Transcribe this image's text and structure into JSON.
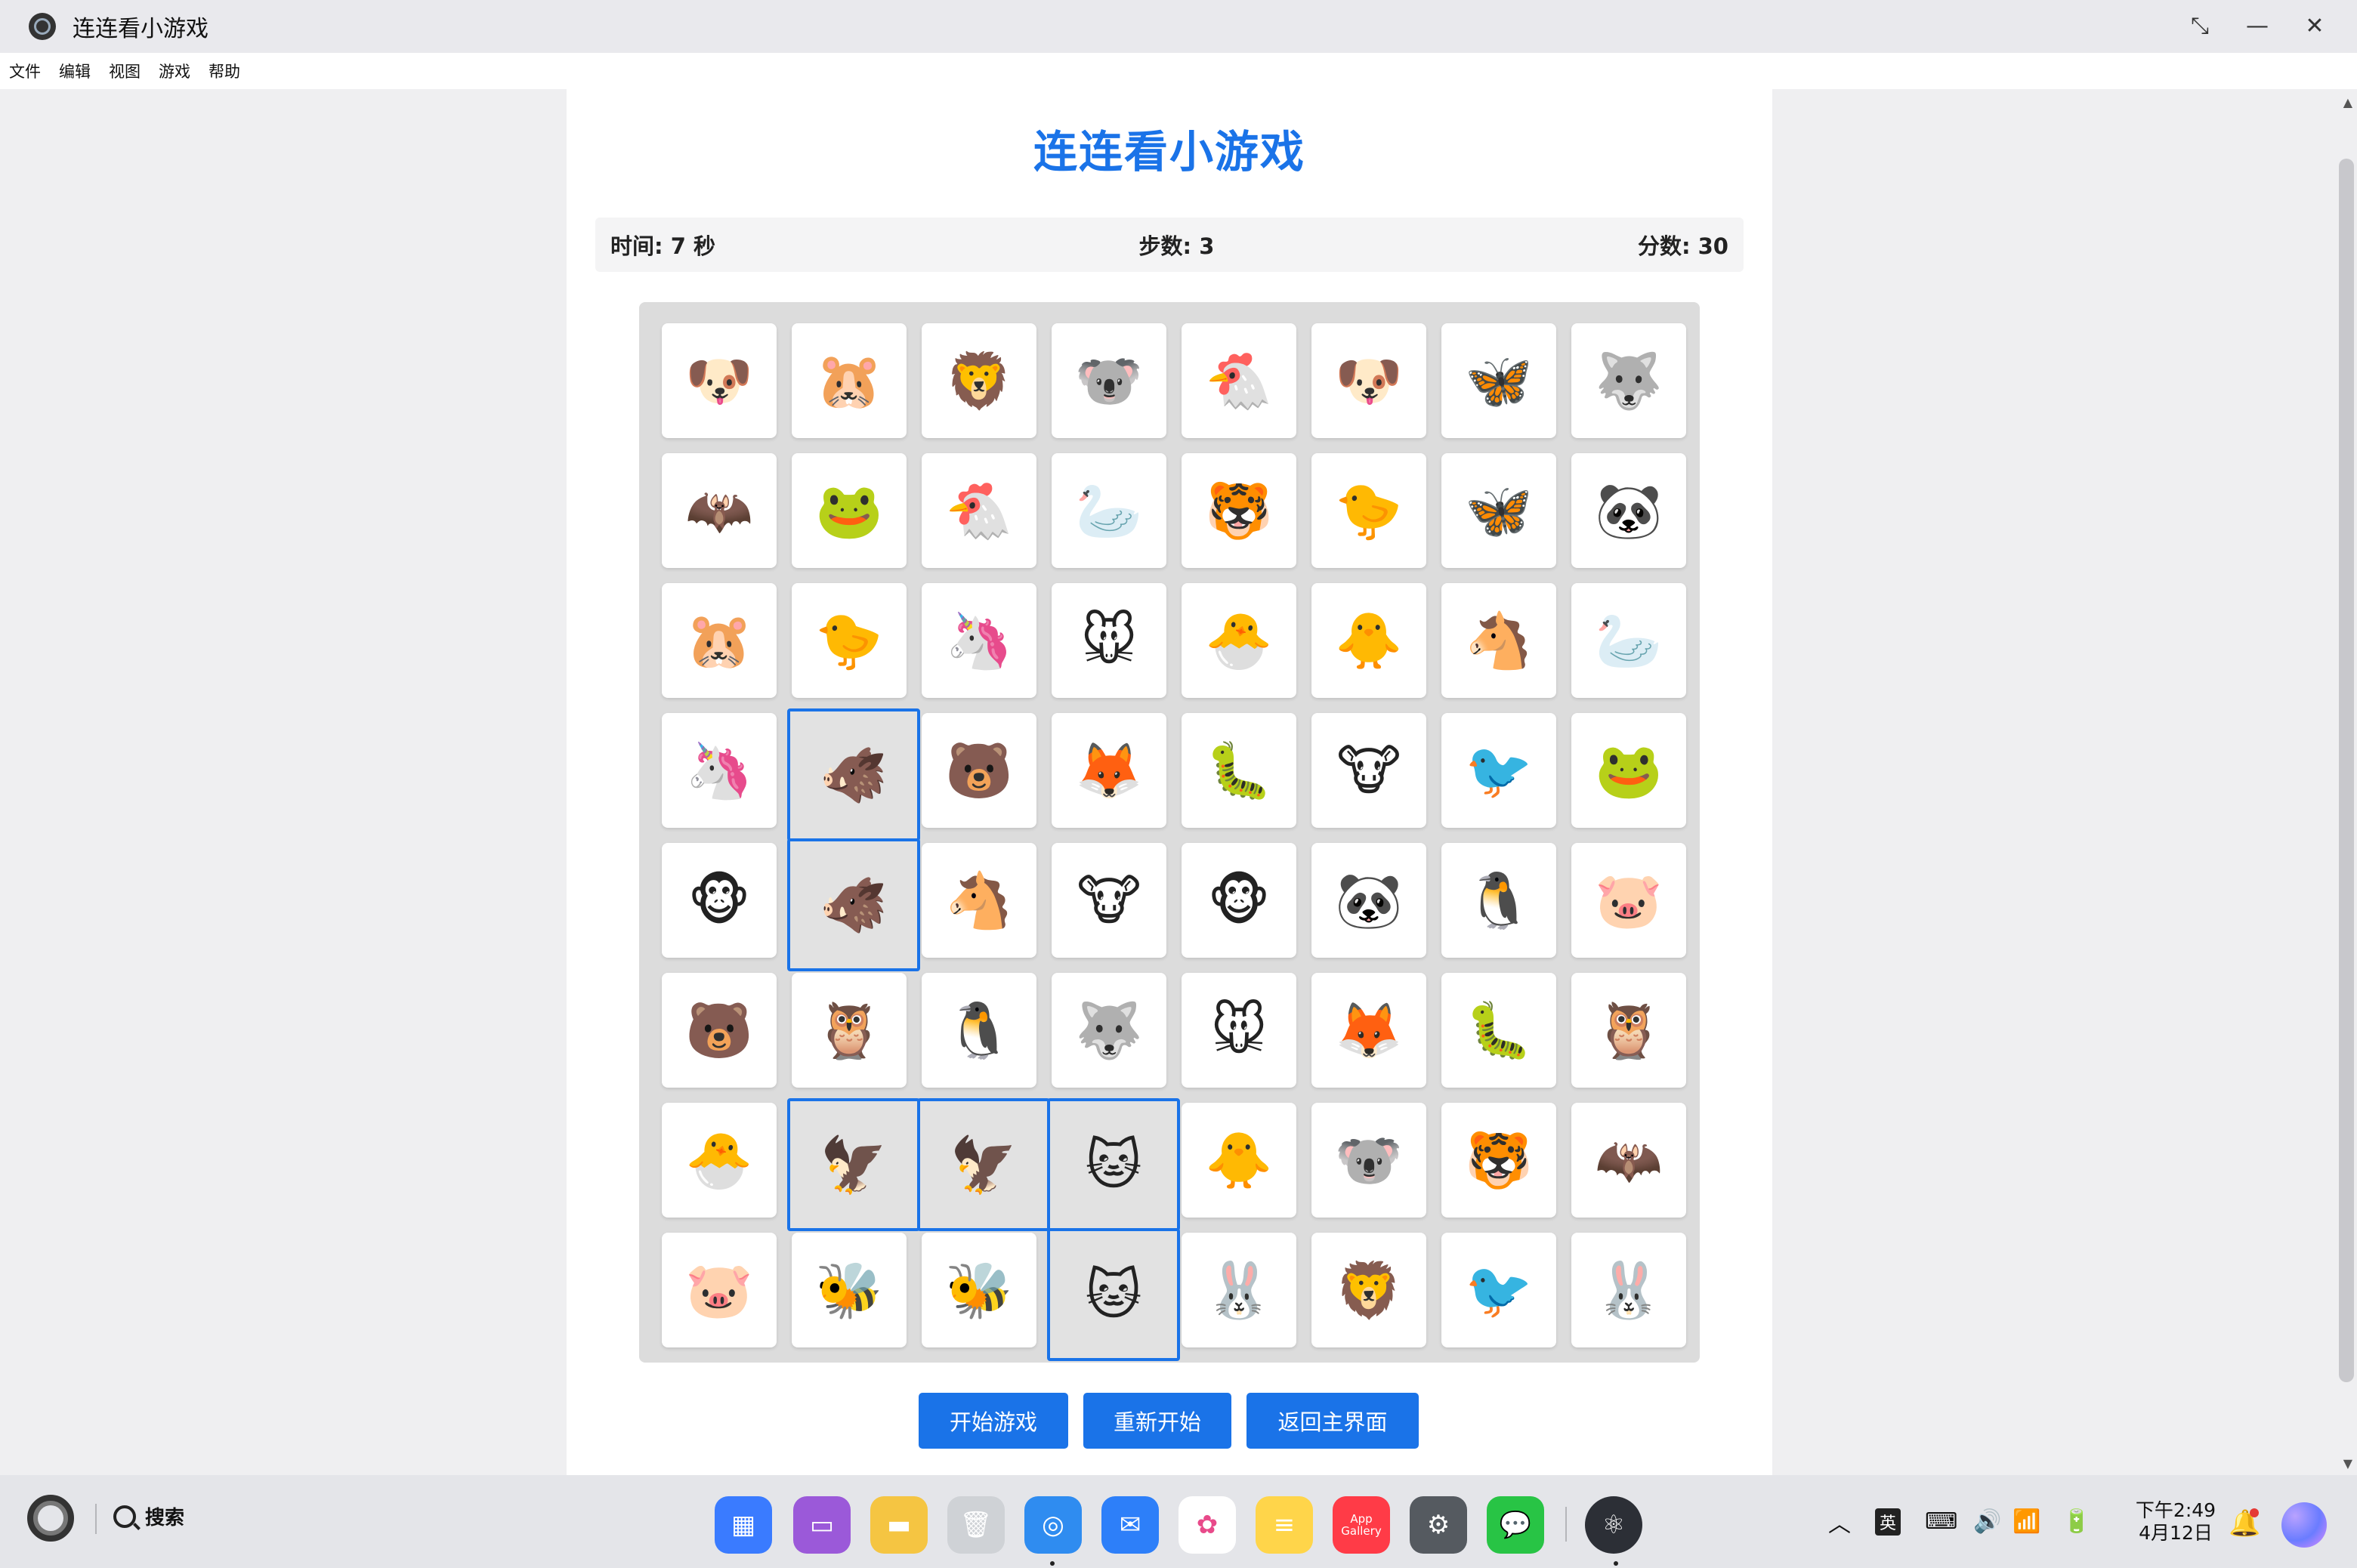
{
  "window": {
    "title": "连连看小游戏",
    "controls": [
      "restore-icon",
      "minimize-icon",
      "close-icon"
    ]
  },
  "menu": [
    "文件",
    "编辑",
    "视图",
    "游戏",
    "帮助"
  ],
  "game": {
    "title": "连连看小游戏",
    "stats": {
      "time": "时间: 7 秒",
      "steps": "步数: 3",
      "score": "分数: 30"
    },
    "grid": [
      [
        "🐶",
        "🐹",
        "🦁",
        "🐨",
        "🐔",
        "🐶",
        "🦋",
        "🐺"
      ],
      [
        "🦇",
        "🐸",
        "🐔",
        "🦢",
        "🐯",
        "🐤",
        "🦋",
        "🐼"
      ],
      [
        "🐹",
        "🐤",
        "🦄",
        "🐭",
        "🐣",
        "🐥",
        "🐴",
        "🦢"
      ],
      [
        "🦄",
        "🐗",
        "🐻",
        "🦊",
        "🐛",
        "🐮",
        "🐦",
        "🐸"
      ],
      [
        "🐵",
        "🐗",
        "🐴",
        "🐮",
        "🐵",
        "🐼",
        "🐧",
        "🐷"
      ],
      [
        "🐻",
        "🦉",
        "🐧",
        "🐺",
        "🐭",
        "🦊",
        "🐛",
        "🦉"
      ],
      [
        "🐣",
        "🦅",
        "🦅",
        "🐱",
        "🐥",
        "🐨",
        "🐯",
        "🦇"
      ],
      [
        "🐷",
        "🐝",
        "🐝",
        "🐱",
        "🐰",
        "🦁",
        "🐦",
        "🐰"
      ]
    ],
    "selected": [
      [
        3,
        1
      ],
      [
        4,
        1
      ],
      [
        6,
        1
      ],
      [
        6,
        2
      ],
      [
        6,
        3
      ],
      [
        7,
        3
      ]
    ],
    "buttons": {
      "start": "开始游戏",
      "restart": "重新开始",
      "back": "返回主界面"
    },
    "accent_color": "#1a73e8"
  },
  "taskbar": {
    "search_label": "搜索",
    "dock": [
      {
        "name": "app-launcher-icon",
        "color": "#3a7bff",
        "glyph": "▦"
      },
      {
        "name": "multitask-icon",
        "color": "#9b59d9",
        "glyph": "▭"
      },
      {
        "name": "files-icon",
        "color": "#f5c542",
        "glyph": "▬"
      },
      {
        "name": "trash-icon",
        "color": "#cfd2d6",
        "glyph": "🗑"
      },
      {
        "name": "browser-icon",
        "color": "#2f8cf0",
        "glyph": "◎"
      },
      {
        "name": "mail-icon",
        "color": "#2d7ff9",
        "glyph": "✉"
      },
      {
        "name": "photos-icon",
        "color": "#ffffff",
        "glyph": "✿"
      },
      {
        "name": "notes-icon",
        "color": "#ffd54a",
        "glyph": "≡"
      },
      {
        "name": "app-gallery-icon",
        "color": "#ff3b47",
        "glyph": "App Gallery"
      },
      {
        "name": "settings-icon",
        "color": "#555a60",
        "glyph": "⚙"
      },
      {
        "name": "wechat-icon",
        "color": "#28c445",
        "glyph": "💬"
      },
      {
        "name": "electron-app-icon",
        "color": "#2c2f36",
        "glyph": "⚛"
      }
    ],
    "tray": {
      "chevron": "^",
      "ime": "英",
      "time": "下午2:49",
      "date": "4月12日"
    }
  }
}
